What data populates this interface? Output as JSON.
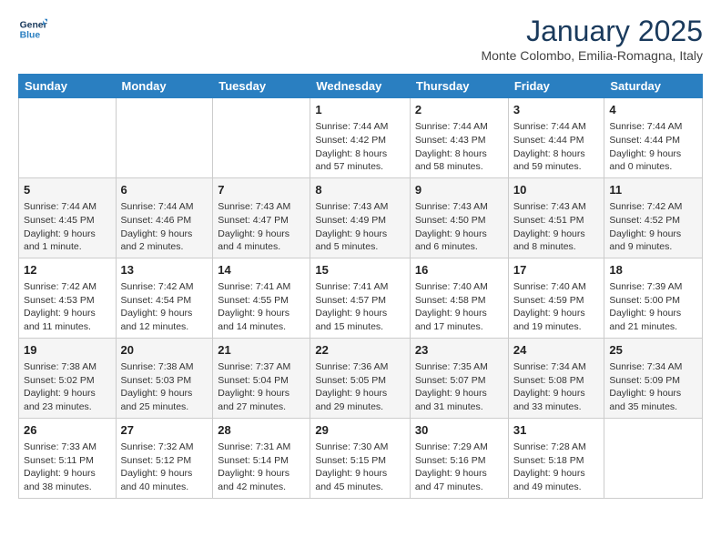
{
  "header": {
    "logo_line1": "General",
    "logo_line2": "Blue",
    "month_title": "January 2025",
    "subtitle": "Monte Colombo, Emilia-Romagna, Italy"
  },
  "weekdays": [
    "Sunday",
    "Monday",
    "Tuesday",
    "Wednesday",
    "Thursday",
    "Friday",
    "Saturday"
  ],
  "weeks": [
    [
      {
        "day": "",
        "text": ""
      },
      {
        "day": "",
        "text": ""
      },
      {
        "day": "",
        "text": ""
      },
      {
        "day": "1",
        "text": "Sunrise: 7:44 AM\nSunset: 4:42 PM\nDaylight: 8 hours and 57 minutes."
      },
      {
        "day": "2",
        "text": "Sunrise: 7:44 AM\nSunset: 4:43 PM\nDaylight: 8 hours and 58 minutes."
      },
      {
        "day": "3",
        "text": "Sunrise: 7:44 AM\nSunset: 4:44 PM\nDaylight: 8 hours and 59 minutes."
      },
      {
        "day": "4",
        "text": "Sunrise: 7:44 AM\nSunset: 4:44 PM\nDaylight: 9 hours and 0 minutes."
      }
    ],
    [
      {
        "day": "5",
        "text": "Sunrise: 7:44 AM\nSunset: 4:45 PM\nDaylight: 9 hours and 1 minute."
      },
      {
        "day": "6",
        "text": "Sunrise: 7:44 AM\nSunset: 4:46 PM\nDaylight: 9 hours and 2 minutes."
      },
      {
        "day": "7",
        "text": "Sunrise: 7:43 AM\nSunset: 4:47 PM\nDaylight: 9 hours and 4 minutes."
      },
      {
        "day": "8",
        "text": "Sunrise: 7:43 AM\nSunset: 4:49 PM\nDaylight: 9 hours and 5 minutes."
      },
      {
        "day": "9",
        "text": "Sunrise: 7:43 AM\nSunset: 4:50 PM\nDaylight: 9 hours and 6 minutes."
      },
      {
        "day": "10",
        "text": "Sunrise: 7:43 AM\nSunset: 4:51 PM\nDaylight: 9 hours and 8 minutes."
      },
      {
        "day": "11",
        "text": "Sunrise: 7:42 AM\nSunset: 4:52 PM\nDaylight: 9 hours and 9 minutes."
      }
    ],
    [
      {
        "day": "12",
        "text": "Sunrise: 7:42 AM\nSunset: 4:53 PM\nDaylight: 9 hours and 11 minutes."
      },
      {
        "day": "13",
        "text": "Sunrise: 7:42 AM\nSunset: 4:54 PM\nDaylight: 9 hours and 12 minutes."
      },
      {
        "day": "14",
        "text": "Sunrise: 7:41 AM\nSunset: 4:55 PM\nDaylight: 9 hours and 14 minutes."
      },
      {
        "day": "15",
        "text": "Sunrise: 7:41 AM\nSunset: 4:57 PM\nDaylight: 9 hours and 15 minutes."
      },
      {
        "day": "16",
        "text": "Sunrise: 7:40 AM\nSunset: 4:58 PM\nDaylight: 9 hours and 17 minutes."
      },
      {
        "day": "17",
        "text": "Sunrise: 7:40 AM\nSunset: 4:59 PM\nDaylight: 9 hours and 19 minutes."
      },
      {
        "day": "18",
        "text": "Sunrise: 7:39 AM\nSunset: 5:00 PM\nDaylight: 9 hours and 21 minutes."
      }
    ],
    [
      {
        "day": "19",
        "text": "Sunrise: 7:38 AM\nSunset: 5:02 PM\nDaylight: 9 hours and 23 minutes."
      },
      {
        "day": "20",
        "text": "Sunrise: 7:38 AM\nSunset: 5:03 PM\nDaylight: 9 hours and 25 minutes."
      },
      {
        "day": "21",
        "text": "Sunrise: 7:37 AM\nSunset: 5:04 PM\nDaylight: 9 hours and 27 minutes."
      },
      {
        "day": "22",
        "text": "Sunrise: 7:36 AM\nSunset: 5:05 PM\nDaylight: 9 hours and 29 minutes."
      },
      {
        "day": "23",
        "text": "Sunrise: 7:35 AM\nSunset: 5:07 PM\nDaylight: 9 hours and 31 minutes."
      },
      {
        "day": "24",
        "text": "Sunrise: 7:34 AM\nSunset: 5:08 PM\nDaylight: 9 hours and 33 minutes."
      },
      {
        "day": "25",
        "text": "Sunrise: 7:34 AM\nSunset: 5:09 PM\nDaylight: 9 hours and 35 minutes."
      }
    ],
    [
      {
        "day": "26",
        "text": "Sunrise: 7:33 AM\nSunset: 5:11 PM\nDaylight: 9 hours and 38 minutes."
      },
      {
        "day": "27",
        "text": "Sunrise: 7:32 AM\nSunset: 5:12 PM\nDaylight: 9 hours and 40 minutes."
      },
      {
        "day": "28",
        "text": "Sunrise: 7:31 AM\nSunset: 5:14 PM\nDaylight: 9 hours and 42 minutes."
      },
      {
        "day": "29",
        "text": "Sunrise: 7:30 AM\nSunset: 5:15 PM\nDaylight: 9 hours and 45 minutes."
      },
      {
        "day": "30",
        "text": "Sunrise: 7:29 AM\nSunset: 5:16 PM\nDaylight: 9 hours and 47 minutes."
      },
      {
        "day": "31",
        "text": "Sunrise: 7:28 AM\nSunset: 5:18 PM\nDaylight: 9 hours and 49 minutes."
      },
      {
        "day": "",
        "text": ""
      }
    ]
  ]
}
